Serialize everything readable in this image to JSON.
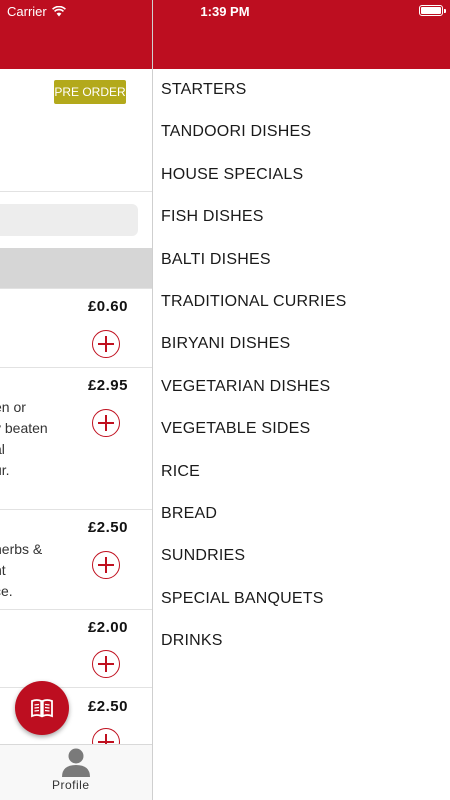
{
  "status_bar": {
    "carrier": "Carrier",
    "time": "1:39 PM"
  },
  "menu_panel": {
    "preorder_label": "PRE ORDER",
    "items": [
      {
        "price": "£0.60",
        "description": []
      },
      {
        "price": "£2.95",
        "description": [
          "en or",
          "y beaten",
          "al",
          "ur."
        ]
      },
      {
        "price": "£2.50",
        "description": [
          "herbs &",
          "nt",
          "ce."
        ]
      },
      {
        "price": "£2.00",
        "description": []
      },
      {
        "price": "£2.50",
        "description": []
      }
    ]
  },
  "tabbar": {
    "profile_label": "Profile"
  },
  "drawer": {
    "categories": [
      "STARTERS",
      "TANDOORI DISHES",
      "HOUSE SPECIALS",
      "FISH DISHES",
      "BALTI DISHES",
      "TRADITIONAL CURRIES",
      "BIRYANI DISHES",
      "VEGETARIAN DISHES",
      "VEGETABLE SIDES",
      "RICE",
      "BREAD",
      "SUNDRIES",
      "SPECIAL BANQUETS",
      "DRINKS"
    ]
  },
  "colors": {
    "brand_red": "#bd0e20",
    "preorder_olive": "#b3a91b"
  },
  "icons": [
    "wifi-icon",
    "battery-icon",
    "add-icon",
    "menu-book-icon",
    "profile-icon"
  ]
}
